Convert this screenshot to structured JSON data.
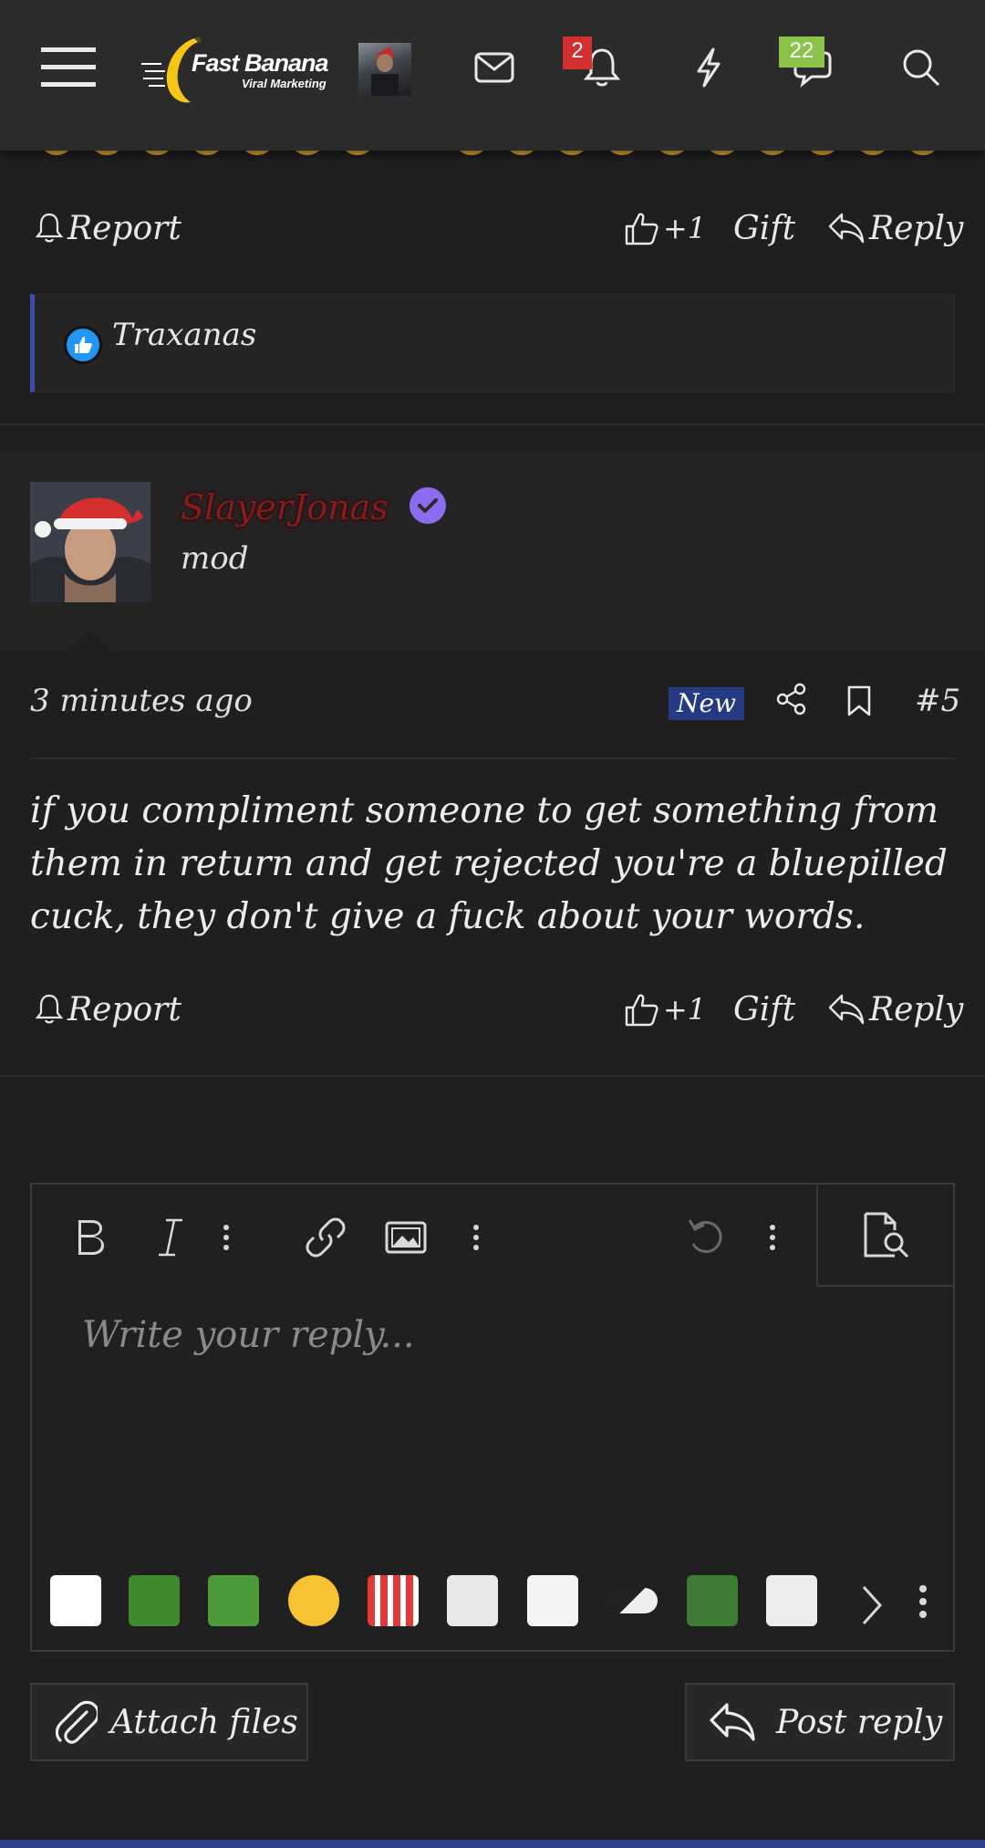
{
  "header": {
    "logo_title": "Fast Banana",
    "logo_subtitle": "Viral Marketing",
    "alerts_count": "2",
    "conversations_count": "22"
  },
  "prev_post": {
    "report_label": "Report",
    "like_count": "+1",
    "gift_label": "Gift",
    "reply_label": "Reply",
    "reaction_user": "Traxanas"
  },
  "post": {
    "username": "SlayerJonas",
    "role": "mod",
    "time": "3 minutes ago",
    "new_badge": "New",
    "post_number": "#5",
    "body": "if you compliment someone to get something from them in return and get rejected you're a bluepilled cuck, they don't give a fuck about your words.",
    "report_label": "Report",
    "like_count": "+1",
    "gift_label": "Gift",
    "reply_label": "Reply"
  },
  "editor": {
    "placeholder": "Write your reply..."
  },
  "footer_buttons": {
    "attach_label": "Attach files",
    "post_label": "Post reply"
  },
  "colors": {
    "background": "#1f1f1f",
    "header": "#2b2b2b",
    "accent_blue": "#253a82",
    "badge_red": "#d32f2f",
    "badge_green": "#8bc34a",
    "username_red": "#8b1a1a",
    "verified_purple": "#8e6cf0"
  },
  "icons": [
    "menu-icon",
    "envelope-icon",
    "bell-icon",
    "bolt-icon",
    "chat-icon",
    "search-icon",
    "like-icon",
    "reply-icon",
    "share-icon",
    "bookmark-icon",
    "paperclip-icon",
    "preview-icon",
    "undo-icon"
  ]
}
